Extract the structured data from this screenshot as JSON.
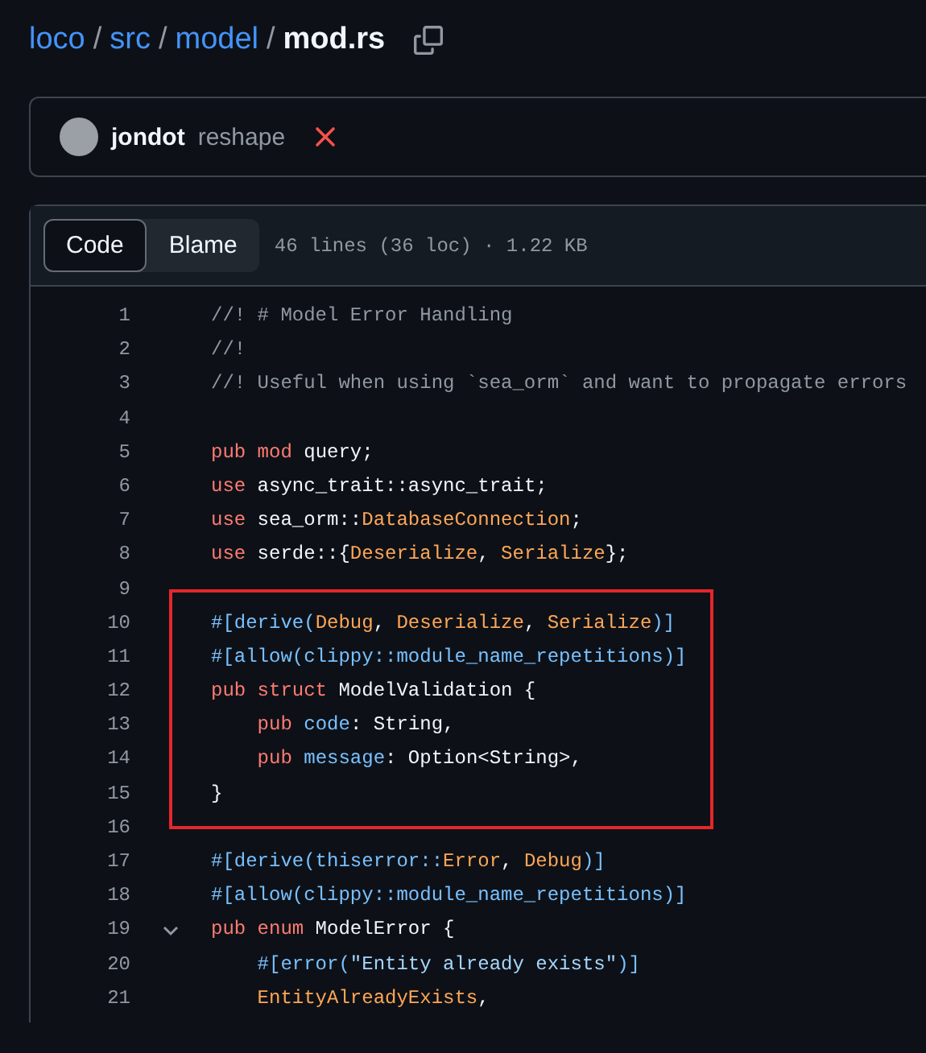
{
  "breadcrumb": {
    "parts": [
      {
        "text": "loco",
        "kind": "link"
      },
      {
        "text": "/",
        "kind": "separator"
      },
      {
        "text": "src",
        "kind": "link"
      },
      {
        "text": "/",
        "kind": "separator"
      },
      {
        "text": "model",
        "kind": "link"
      },
      {
        "text": "/",
        "kind": "separator"
      },
      {
        "text": "mod.rs",
        "kind": "current"
      }
    ]
  },
  "commit": {
    "author": "jondot",
    "message": "reshape",
    "checks_failed": true
  },
  "file": {
    "tabs": [
      {
        "label": "Code",
        "selected": true
      },
      {
        "label": "Blame",
        "selected": false
      }
    ],
    "info": "46 lines (36 loc) · 1.22 KB",
    "blocks": [
      {
        "kind": "plain",
        "lines": [
          {
            "number": "1",
            "tokens": [
              {
                "kind": "comment",
                "text": "//! # Model Error Handling"
              }
            ]
          },
          {
            "number": "2",
            "tokens": [
              {
                "kind": "comment",
                "text": "//!"
              }
            ]
          },
          {
            "number": "3",
            "tokens": [
              {
                "kind": "comment",
                "text": "//! Useful when using `sea_orm` and want to propagate errors"
              }
            ]
          },
          {
            "number": "4"
          },
          {
            "number": "5",
            "tokens": [
              {
                "kind": "keyword",
                "text": "pub mod"
              },
              {
                "kind": "plain",
                "text": " query;"
              }
            ]
          },
          {
            "number": "6",
            "tokens": [
              {
                "kind": "keyword",
                "text": "use"
              },
              {
                "kind": "plain",
                "text": " async_trait::async_trait;"
              }
            ]
          },
          {
            "number": "7",
            "tokens": [
              {
                "kind": "keyword",
                "text": "use"
              },
              {
                "kind": "plain",
                "text": " sea_orm::"
              },
              {
                "kind": "type",
                "text": "DatabaseConnection"
              },
              {
                "kind": "plain",
                "text": ";"
              }
            ]
          },
          {
            "number": "8",
            "tokens": [
              {
                "kind": "keyword",
                "text": "use"
              },
              {
                "kind": "plain",
                "text": " serde::{"
              },
              {
                "kind": "type",
                "text": "Deserialize"
              },
              {
                "kind": "plain",
                "text": ", "
              },
              {
                "kind": "type",
                "text": "Serialize"
              },
              {
                "kind": "plain",
                "text": "};"
              }
            ]
          },
          {
            "number": "9"
          }
        ]
      },
      {
        "kind": "highlighted",
        "lines": [
          {
            "number": "10",
            "tokens": [
              {
                "kind": "attr",
                "text": "#[derive("
              },
              {
                "kind": "type",
                "text": "Debug"
              },
              {
                "kind": "plain",
                "text": ", "
              },
              {
                "kind": "type",
                "text": "Deserialize"
              },
              {
                "kind": "plain",
                "text": ", "
              },
              {
                "kind": "type",
                "text": "Serialize"
              },
              {
                "kind": "attr",
                "text": ")]"
              }
            ]
          },
          {
            "number": "11",
            "tokens": [
              {
                "kind": "attr",
                "text": "#[allow(clippy::module_name_repetitions)]"
              }
            ]
          },
          {
            "number": "12",
            "tokens": [
              {
                "kind": "keyword",
                "text": "pub struct"
              },
              {
                "kind": "plain",
                "text": " ModelValidation {"
              }
            ]
          },
          {
            "number": "13",
            "tokens": [
              {
                "kind": "keyword",
                "text": "    pub"
              },
              {
                "kind": "attr",
                "text": " code"
              },
              {
                "kind": "plain",
                "text": ": String,"
              }
            ]
          },
          {
            "number": "14",
            "tokens": [
              {
                "kind": "keyword",
                "text": "    pub"
              },
              {
                "kind": "attr",
                "text": " message"
              },
              {
                "kind": "plain",
                "text": ": Option<String>,"
              }
            ]
          },
          {
            "number": "15",
            "tokens": [
              {
                "kind": "plain",
                "text": "}"
              }
            ]
          }
        ]
      },
      {
        "kind": "plain",
        "lines": [
          {
            "number": "16"
          },
          {
            "number": "17",
            "tokens": [
              {
                "kind": "attr",
                "text": "#[derive(thiserror::"
              },
              {
                "kind": "type",
                "text": "Error"
              },
              {
                "kind": "plain",
                "text": ", "
              },
              {
                "kind": "type",
                "text": "Debug"
              },
              {
                "kind": "attr",
                "text": ")]"
              }
            ]
          },
          {
            "number": "18",
            "tokens": [
              {
                "kind": "attr",
                "text": "#[allow(clippy::module_name_repetitions)]"
              }
            ]
          },
          {
            "number": "19",
            "expanded": true,
            "tokens": [
              {
                "kind": "keyword",
                "text": "pub enum"
              },
              {
                "kind": "plain",
                "text": " ModelError {"
              }
            ]
          },
          {
            "number": "20",
            "tokens": [
              {
                "kind": "attr",
                "text": "    #[error("
              },
              {
                "kind": "string",
                "text": "\"Entity already exists\""
              },
              {
                "kind": "attr",
                "text": ")]"
              }
            ]
          },
          {
            "number": "21",
            "tokens": [
              {
                "kind": "type",
                "text": "    EntityAlreadyExists"
              },
              {
                "kind": "plain",
                "text": ","
              }
            ]
          }
        ]
      }
    ]
  }
}
